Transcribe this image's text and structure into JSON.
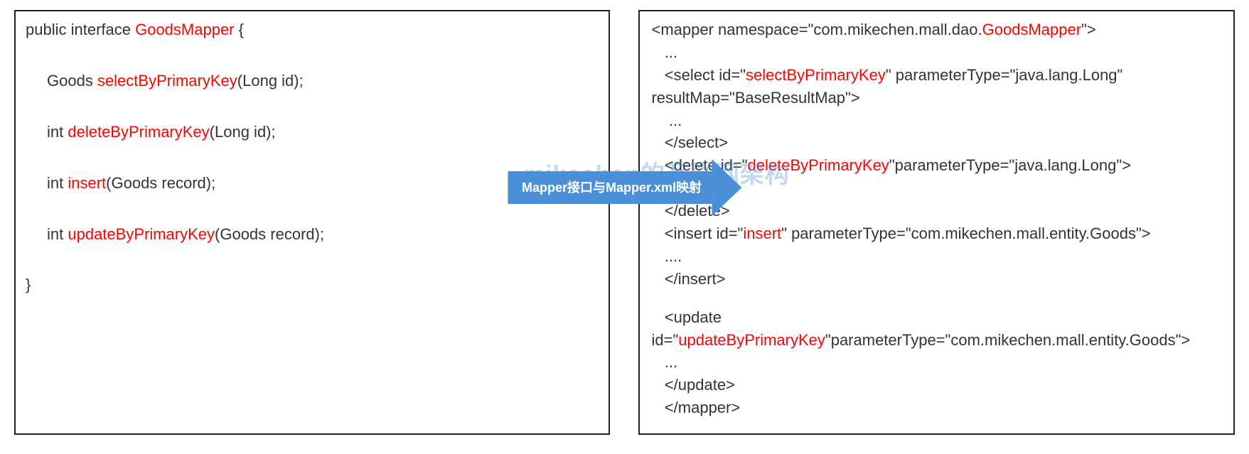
{
  "watermark": "mikechen的互联网架构",
  "arrow_label": "Mapper接口与Mapper.xml映射",
  "java": {
    "l1_a": "public interface ",
    "l1_b": "GoodsMapper",
    "l1_c": " {",
    "l2_a": "Goods ",
    "l2_b": "selectByPrimaryKey",
    "l2_c": "(Long id);",
    "l3_a": "int ",
    "l3_b": "deleteByPrimaryKey",
    "l3_c": "(Long id);",
    "l4_a": "int ",
    "l4_b": "insert",
    "l4_c": "(Goods record);",
    "l5_a": "int ",
    "l5_b": "updateByPrimaryKey",
    "l5_c": "(Goods record);",
    "l6": "}"
  },
  "xml": {
    "l1_a": "<mapper namespace=\"com.mikechen.mall.dao.",
    "l1_b": "GoodsMapper",
    "l1_c": "\">",
    "l2": "   ...",
    "l3_a": "   <select id=\"",
    "l3_b": "selectByPrimaryKey",
    "l3_c": "\" parameterType=\"java.lang.Long\"",
    "l4": "resultMap=\"BaseResultMap\">",
    "l5": "    ...",
    "l6": "   </select>",
    "l7_a": "   <delete id=\"",
    "l7_b": "deleteByPrimaryKey",
    "l7_c": "\"parameterType=\"java.lang.Long\">",
    "l8": "     ...",
    "l9": "   </delete>",
    "l10_a": "   <insert id=\"",
    "l10_b": "insert",
    "l10_c": "\" parameterType=\"com.mikechen.mall.entity.Goods\">",
    "l11": "   ....",
    "l12": "   </insert>",
    "l13": "   <update",
    "l14_a": "id=\"",
    "l14_b": "updateByPrimaryKey",
    "l14_c": "\"parameterType=\"com.mikechen.mall.entity.Goods\">",
    "l15": "   ...",
    "l16": "   </update>",
    "l17": "   </mapper>"
  }
}
